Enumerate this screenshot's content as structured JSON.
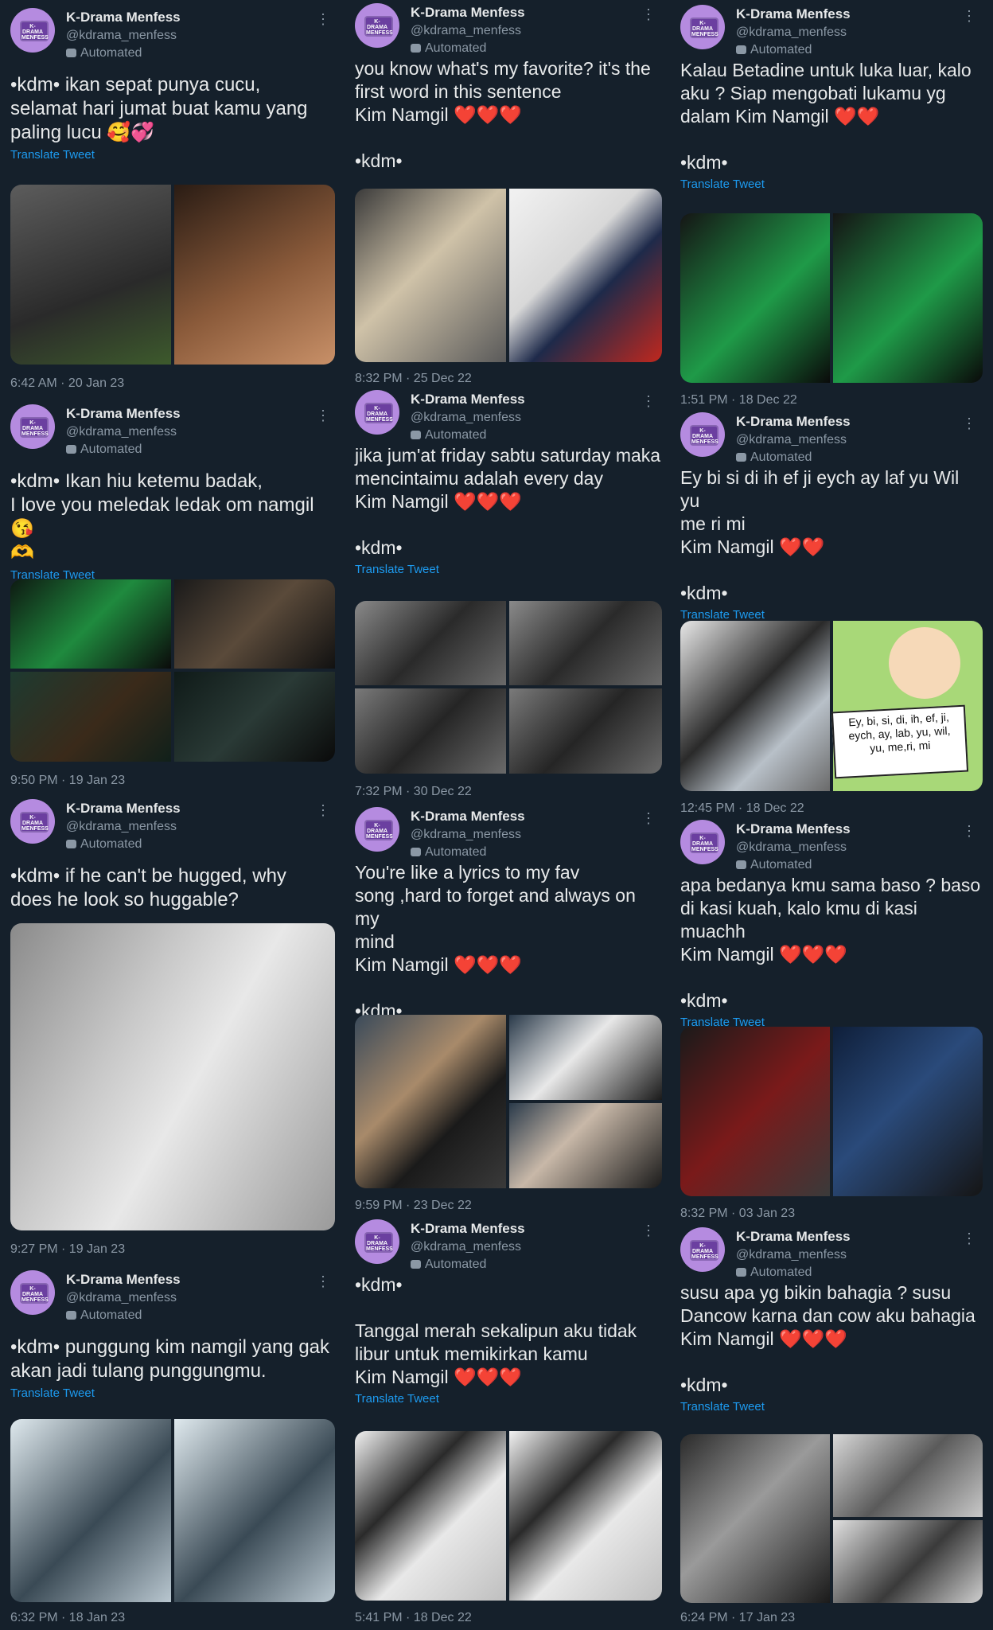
{
  "account": {
    "name": "K-Drama Menfess",
    "handle": "@kdrama_menfess",
    "automated": "Automated",
    "avatar_text": "K-DRAMA MENFESS"
  },
  "translate_label": "Translate Tweet",
  "more_label": "⋮",
  "columns": [
    {
      "tweets": [
        {
          "text": "•kdm• ikan sepat punya cucu,\nselamat hari jumat buat kamu yang\npaling lucu 🥰💞",
          "translate": true,
          "timestamp": "6:42 AM · 20 Jan 23"
        },
        {
          "text": "•kdm• Ikan hiu ketemu badak,\nI love you meledak ledak om namgil😘\n🫶",
          "translate": true,
          "timestamp": "9:50 PM · 19 Jan 23"
        },
        {
          "text": "•kdm• if he can't be hugged, why\ndoes he look so huggable?",
          "translate": false,
          "timestamp": "9:27 PM · 19 Jan 23"
        },
        {
          "text": "•kdm• punggung kim namgil yang gak\nakan jadi tulang punggungmu.",
          "translate": true,
          "timestamp": "6:32 PM · 18 Jan 23"
        }
      ]
    },
    {
      "tweets": [
        {
          "text": "you know what's my favorite? it's the\nfirst word in this sentence\nKim Namgil ❤️❤️❤️\n\n•kdm•",
          "translate": false,
          "timestamp": "8:32 PM · 25 Dec 22"
        },
        {
          "text": "jika jum'at friday sabtu saturday maka\nmencintaimu adalah every day\nKim Namgil ❤️❤️❤️\n\n•kdm•",
          "translate": true,
          "timestamp": "7:32 PM · 30 Dec 22"
        },
        {
          "text": "You're like a lyrics to my fav\nsong ,hard to forget and always on my\nmind\nKim Namgil ❤️❤️❤️\n\n•kdm•",
          "translate": false,
          "timestamp": "9:59 PM · 23 Dec 22"
        },
        {
          "text": "•kdm•\n\nTanggal merah sekalipun aku tidak\nlibur untuk memikirkan kamu\nKim Namgil ❤️❤️❤️",
          "translate": true,
          "timestamp": "5:41 PM · 18 Dec 22"
        }
      ]
    },
    {
      "tweets": [
        {
          "text": "Kalau Betadine untuk luka luar, kalo\naku ? Siap mengobati lukamu yg\ndalam Kim Namgil ❤️❤️\n\n•kdm•",
          "translate": true,
          "timestamp": "1:51 PM · 18 Dec 22"
        },
        {
          "text": "Ey bi si di ih ef ji eych ay laf yu Wil yu\nme ri mi\nKim Namgil ❤️❤️\n\n•kdm•",
          "translate": true,
          "timestamp": "12:45 PM · 18 Dec 22"
        },
        {
          "text": "apa bedanya kmu sama baso ? baso\ndi kasi kuah, kalo kmu di kasi muachh\nKim Namgil ❤️❤️❤️\n\n•kdm•",
          "translate": true,
          "timestamp": "8:32 PM · 03 Jan 23"
        },
        {
          "text": "susu apa yg bikin bahagia ? susu\nDancow karna dan cow aku bahagia\nKim Namgil ❤️❤️❤️\n\n•kdm•",
          "translate": true,
          "timestamp": "6:24 PM · 17 Jan 23"
        }
      ]
    }
  ],
  "comic_caption": "Ey, bi, si, di, ih, ef, ji,\neych, ay, lab, yu, wil,\nyu, me,ri, mi",
  "colors": {
    "background": "#15202b",
    "link": "#1d9bf0",
    "muted": "#8b98a5",
    "heart": "#f91880"
  }
}
